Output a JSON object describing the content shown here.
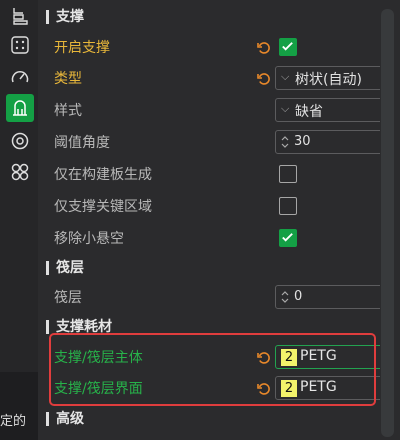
{
  "sidebar": {
    "icons": [
      "layers-icon",
      "grid-dots-icon",
      "speed-gauge-icon",
      "support-icon",
      "settings-target-icon",
      "flower-icon"
    ],
    "active": "support-icon"
  },
  "bottom_left_text": "定的",
  "colors": {
    "accent_green": "#14a045",
    "highlight_yellow": "#e8b73a",
    "highlight_box_red": "#e03d3d"
  },
  "sections": {
    "support": {
      "title": "支撑",
      "enable_support": {
        "label": "开启支撑",
        "checked": true
      },
      "type": {
        "label": "类型",
        "value": "树状(自动)"
      },
      "style": {
        "label": "样式",
        "value": "缺省"
      },
      "threshold_angle": {
        "label": "阈值角度",
        "value": "30"
      },
      "on_build_plate_only": {
        "label": "仅在构建板生成",
        "checked": false
      },
      "critical_regions_only": {
        "label": "仅支撑关键区域",
        "checked": false
      },
      "remove_small_overhangs": {
        "label": "移除小悬空",
        "checked": true
      }
    },
    "raft": {
      "title": "筏层",
      "raft_layers": {
        "label": "筏层",
        "value": "0"
      }
    },
    "support_filament": {
      "title": "支撑耗材",
      "base": {
        "label": "支撑/筏层主体",
        "number": "2",
        "filament": "PETG"
      },
      "interface": {
        "label": "支撑/筏层界面",
        "number": "2",
        "filament": "PETG"
      }
    },
    "advanced": {
      "title": "高级"
    }
  }
}
